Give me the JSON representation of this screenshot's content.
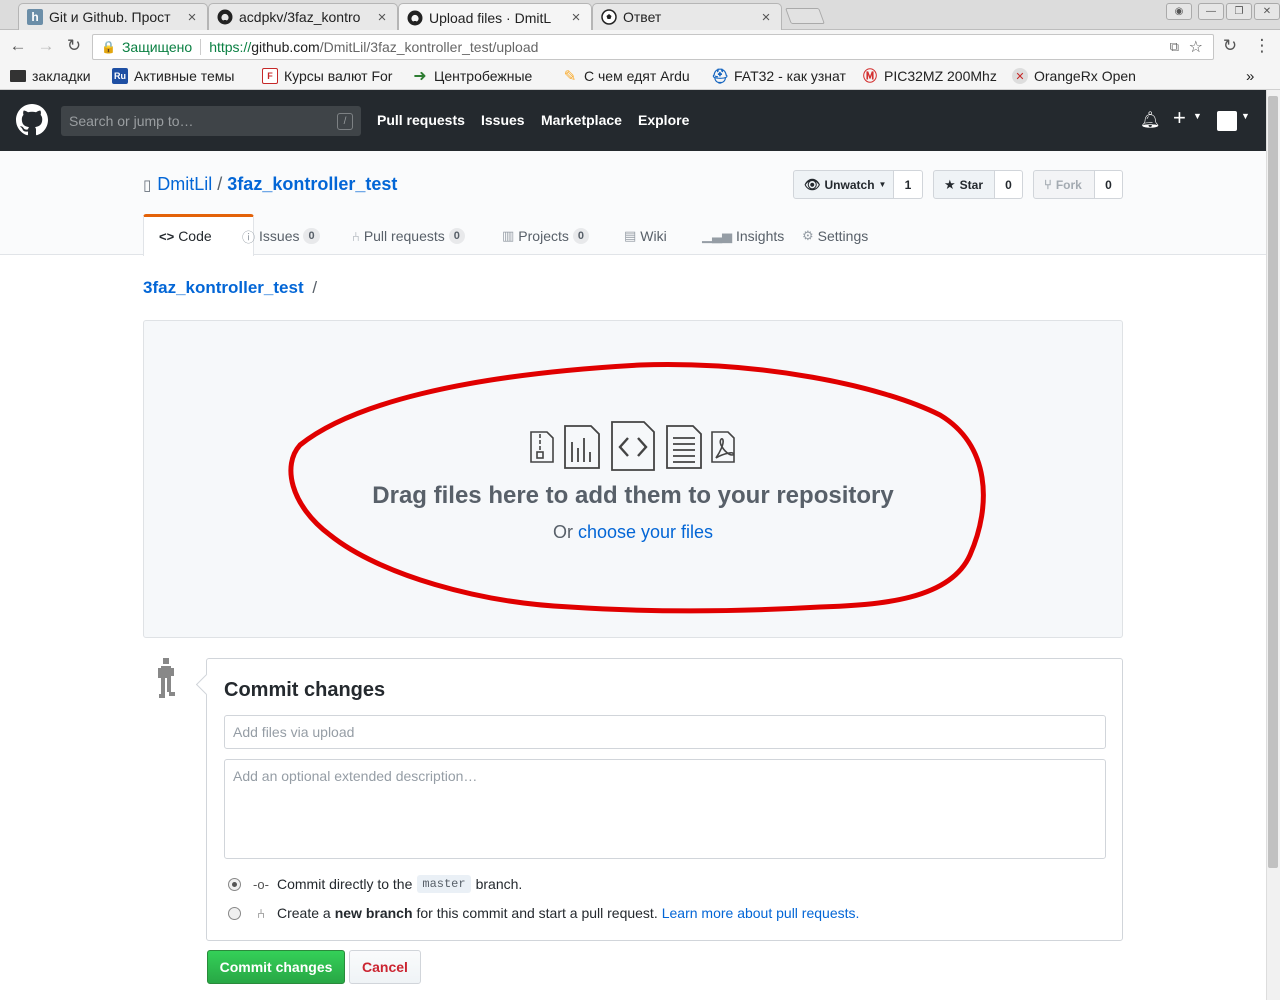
{
  "browser": {
    "tabs": [
      {
        "title": "Git и Github. Прост",
        "favicon": "h"
      },
      {
        "title": "acdpkv/3faz_kontro",
        "favicon": "github-icon"
      },
      {
        "title": "Upload files · DmitL",
        "favicon": "github-icon"
      },
      {
        "title": "Ответ",
        "favicon": "soccer-ball-icon"
      }
    ],
    "secure_label": "Защищено",
    "url_proto": "https://",
    "url_host": "github.com",
    "url_path": "/DmitLil/3faz_kontroller_test/upload",
    "bookmarks": [
      {
        "label": "закладки",
        "icon": "folder-icon",
        "color": "#333333"
      },
      {
        "label": "Активные темы",
        "icon": "Ru",
        "color": "#1e4fa3"
      },
      {
        "label": "Курсы валют For",
        "icon": "F",
        "color": "#c62828"
      },
      {
        "label": "Центробежные",
        "icon": "arrow-icon",
        "color": "#2e7d32"
      },
      {
        "label": "С чем едят Ardu",
        "icon": "pencil-icon",
        "color": "#f9a825"
      },
      {
        "label": "FAT32 - как узнат",
        "icon": "helmet-icon",
        "color": "#1565c0"
      },
      {
        "label": "PIC32MZ 200Mhz",
        "icon": "microchip-icon",
        "color": "#d32f2f"
      },
      {
        "label": "OrangeRx Open",
        "icon": "orangerx-icon",
        "color": "#c62828"
      }
    ]
  },
  "github": {
    "search_placeholder": "Search or jump to…",
    "search_key": "/",
    "nav": [
      "Pull requests",
      "Issues",
      "Marketplace",
      "Explore"
    ]
  },
  "repo": {
    "owner": "DmitLil",
    "separator": "/",
    "name": "3faz_kontroller_test",
    "unwatch_label": "Unwatch",
    "unwatch_count": "1",
    "star_label": "Star",
    "star_count": "0",
    "fork_label": "Fork",
    "fork_count": "0",
    "tabs": [
      {
        "label": "Code",
        "counter": ""
      },
      {
        "label": "Issues",
        "counter": "0"
      },
      {
        "label": "Pull requests",
        "counter": "0"
      },
      {
        "label": "Projects",
        "counter": "0"
      },
      {
        "label": "Wiki",
        "counter": ""
      },
      {
        "label": "Insights",
        "counter": ""
      },
      {
        "label": "Settings",
        "counter": ""
      }
    ]
  },
  "breadcrumb": {
    "repo": "3faz_kontroller_test",
    "slash": "/"
  },
  "dropzone": {
    "title": "Drag files here to add them to your repository",
    "or": "Or",
    "choose_link": "choose your files",
    "annotation_color": "#e00000"
  },
  "commit": {
    "title": "Commit changes",
    "message_placeholder": "Add files via upload",
    "description_placeholder": "Add an optional extended description…",
    "option_direct_pre": "Commit directly to the",
    "branch": "master",
    "option_direct_post": "branch.",
    "option_new_pre": "Create a",
    "option_new_bold": "new branch",
    "option_new_post": "for this commit and start a pull request.",
    "learn_more": "Learn more about pull requests.",
    "commit_button": "Commit changes",
    "cancel_button": "Cancel"
  }
}
